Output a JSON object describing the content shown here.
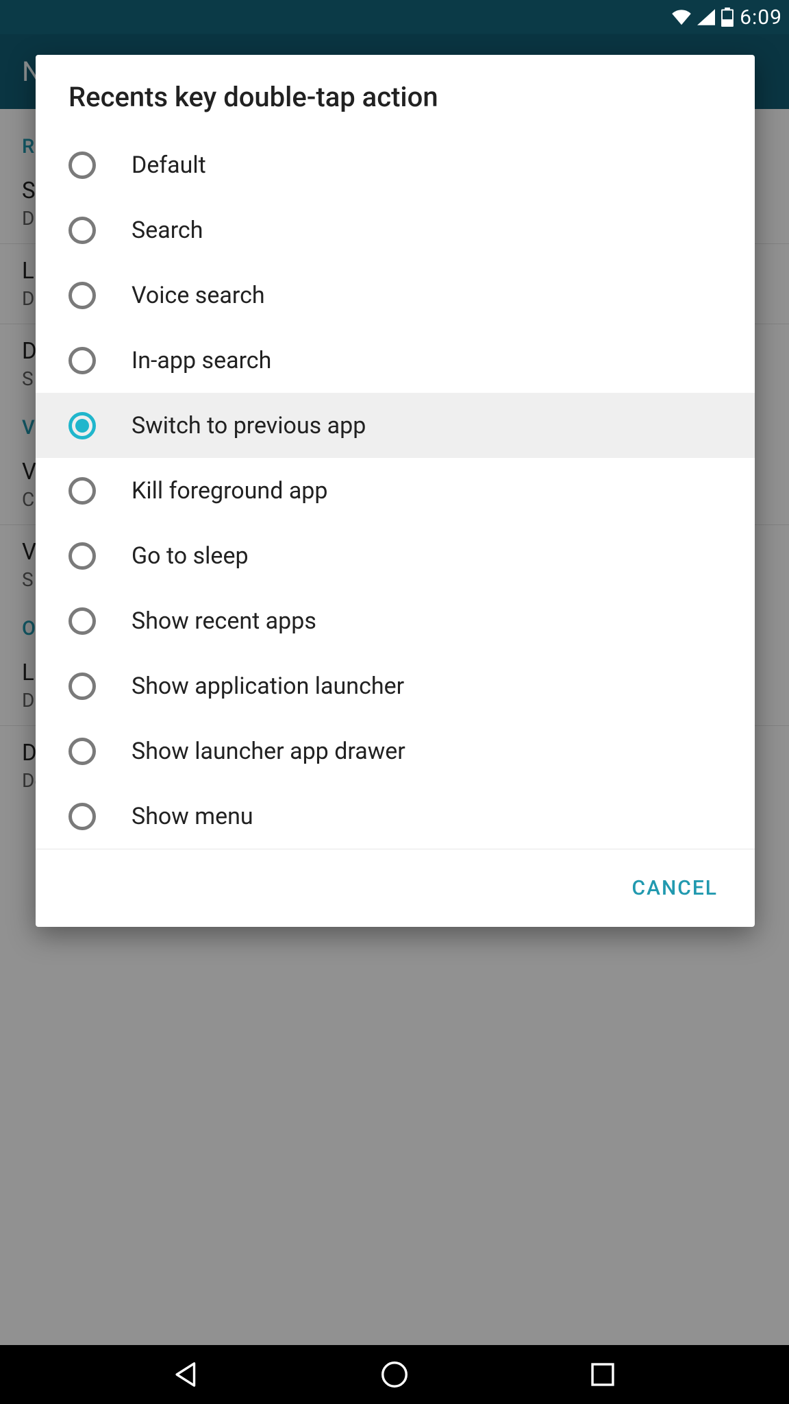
{
  "status_bar": {
    "time": "6:09",
    "battery_level": "49"
  },
  "app_bar": {
    "title": "N"
  },
  "background_settings": {
    "section_r": "R",
    "items": [
      {
        "title": "S",
        "sub": "D"
      },
      {
        "title": "L",
        "sub": "D"
      },
      {
        "title": "D",
        "sub": "S"
      }
    ],
    "section_v": "V",
    "items_v": [
      {
        "title": "V",
        "sub": "C"
      },
      {
        "title": "V",
        "sub": "S"
      }
    ],
    "section_o": "O",
    "items_o": [
      {
        "title": "L",
        "sub": "D"
      },
      {
        "title": "D",
        "sub": "Defines how fast key must be tapped to trigger double-tap"
      }
    ]
  },
  "dialog": {
    "title": "Recents key double-tap action",
    "options": [
      "Default",
      "Search",
      "Voice search",
      "In-app search",
      "Switch to previous app",
      "Kill foreground app",
      "Go to sleep",
      "Show recent apps",
      "Show application launcher",
      "Show launcher app drawer",
      "Show menu"
    ],
    "selected_index": 4,
    "cancel_label": "CANCEL"
  }
}
